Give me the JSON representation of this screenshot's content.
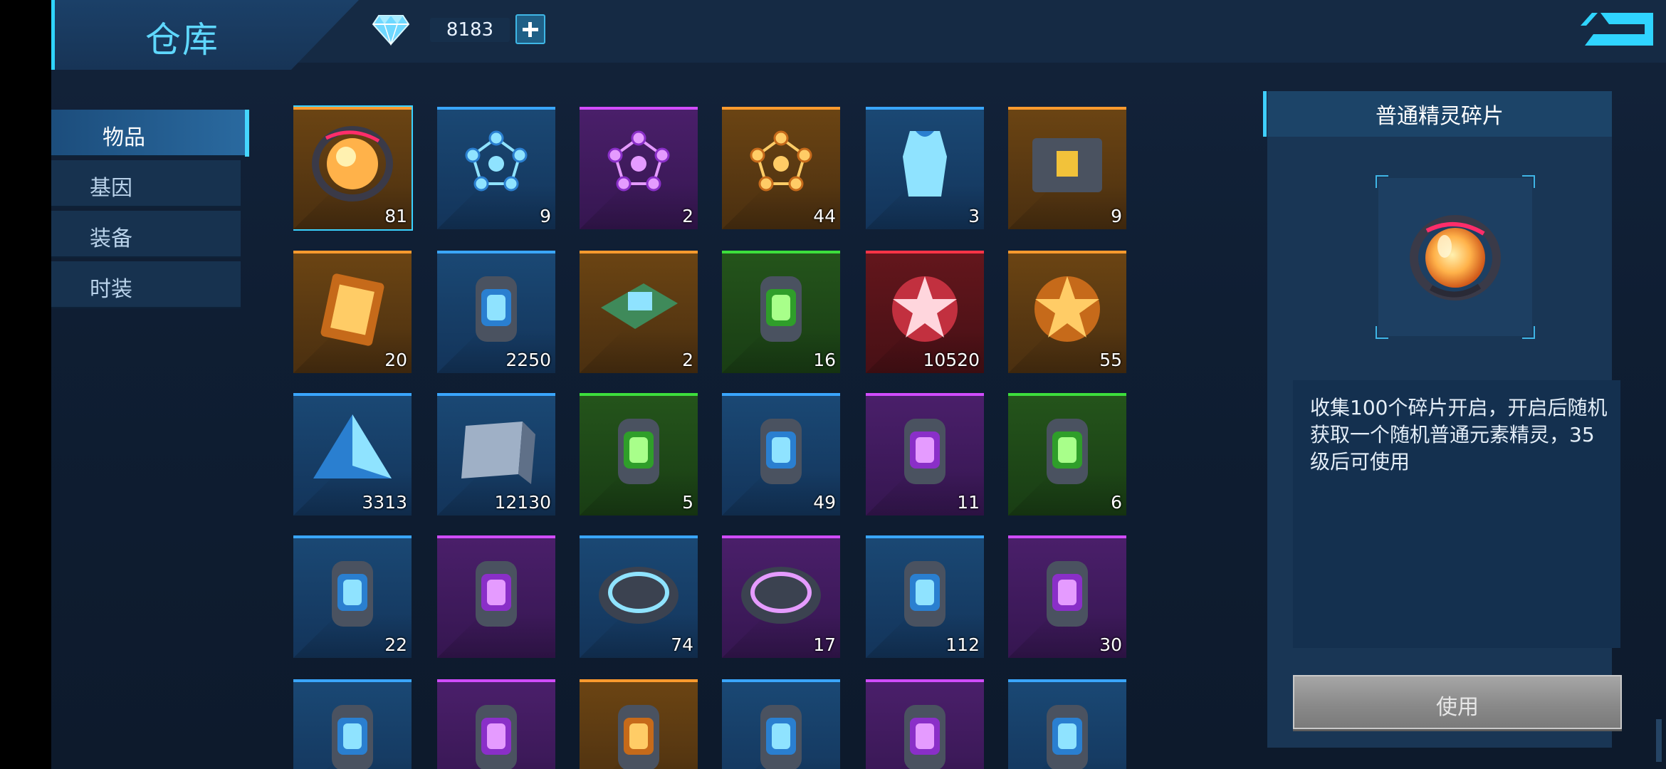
{
  "header": {
    "title": "仓库",
    "diamond_count": "8183"
  },
  "sidebar": {
    "tabs": [
      {
        "label": "物品",
        "active": true
      },
      {
        "label": "基因",
        "active": false
      },
      {
        "label": "装备",
        "active": false
      },
      {
        "label": "时装",
        "active": false
      }
    ]
  },
  "inventory": {
    "items": [
      {
        "icon": "sprite-capsule-icon",
        "count": "81",
        "rarity": "orange"
      },
      {
        "icon": "blue-molecule-icon",
        "count": "9",
        "rarity": "blue"
      },
      {
        "icon": "purple-molecule-icon",
        "count": "2",
        "rarity": "purple"
      },
      {
        "icon": "gold-molecule-icon",
        "count": "44",
        "rarity": "orange"
      },
      {
        "icon": "outfit-fragment-icon",
        "count": "3",
        "rarity": "blue"
      },
      {
        "icon": "mystery-chest-icon",
        "count": "9",
        "rarity": "orange"
      },
      {
        "icon": "rune-card-icon",
        "count": "20",
        "rarity": "orange"
      },
      {
        "icon": "energy-cylinder-icon",
        "count": "2250",
        "rarity": "blue"
      },
      {
        "icon": "circuit-chip-icon",
        "count": "2",
        "rarity": "orange"
      },
      {
        "icon": "green-vial-icon",
        "count": "16",
        "rarity": "green"
      },
      {
        "icon": "star-medal-icon",
        "count": "10520",
        "rarity": "red"
      },
      {
        "icon": "gold-emblem-icon",
        "count": "55",
        "rarity": "orange"
      },
      {
        "icon": "blue-pyramid-icon",
        "count": "3313",
        "rarity": "blue"
      },
      {
        "icon": "metal-plate-icon",
        "count": "12130",
        "rarity": "blue"
      },
      {
        "icon": "green-blaster-icon",
        "count": "5",
        "rarity": "green"
      },
      {
        "icon": "blue-canister-icon",
        "count": "49",
        "rarity": "blue"
      },
      {
        "icon": "purple-canister-icon",
        "count": "11",
        "rarity": "purple"
      },
      {
        "icon": "green-container-icon",
        "count": "6",
        "rarity": "green"
      },
      {
        "icon": "blue-claw-icon",
        "count": "22",
        "rarity": "blue"
      },
      {
        "icon": "purple-claw-icon",
        "count": "",
        "rarity": "purple"
      },
      {
        "icon": "blue-disc-icon",
        "count": "74",
        "rarity": "blue"
      },
      {
        "icon": "purple-disc-icon",
        "count": "17",
        "rarity": "purple"
      },
      {
        "icon": "blue-cannon-icon",
        "count": "112",
        "rarity": "blue"
      },
      {
        "icon": "purple-cannon-icon",
        "count": "30",
        "rarity": "purple"
      },
      {
        "icon": "blue-module-icon",
        "count": "",
        "rarity": "blue"
      },
      {
        "icon": "purple-module-icon",
        "count": "",
        "rarity": "purple"
      },
      {
        "icon": "orange-module-icon",
        "count": "",
        "rarity": "orange"
      },
      {
        "icon": "blue-reactor-icon",
        "count": "",
        "rarity": "blue"
      },
      {
        "icon": "purple-reactor-icon",
        "count": "",
        "rarity": "purple"
      },
      {
        "icon": "blue-gauntlet-icon",
        "count": "",
        "rarity": "blue"
      }
    ]
  },
  "detail": {
    "title": "普通精灵碎片",
    "icon": "sprite-capsule-icon",
    "description": "收集100个碎片开启，开启后随机获取一个随机普通元素精灵，35级后可使用",
    "use_label": "使用"
  },
  "colors": {
    "accent": "#3fcfff",
    "orange": "#ff9a2e",
    "blue": "#3aa6ff",
    "purple": "#d14cff",
    "green": "#3ddf3c",
    "red": "#ff3447"
  }
}
